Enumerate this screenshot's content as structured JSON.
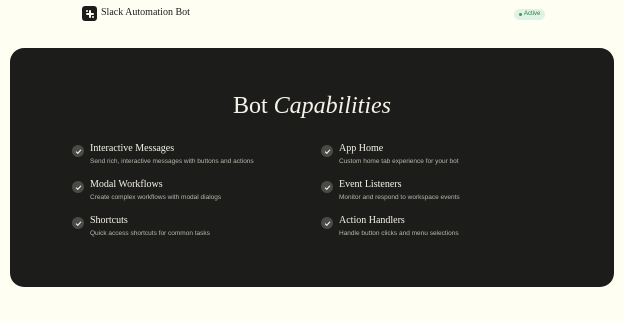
{
  "header": {
    "brand": "Slack Automation Bot",
    "status": "Active",
    "logo_icon": "slack-logo-icon"
  },
  "section": {
    "title_plain": "Bot",
    "title_italic": "Capabilities"
  },
  "features": [
    {
      "name": "Interactive Messages",
      "description": "Send rich, interactive messages with buttons and actions"
    },
    {
      "name": "App Home",
      "description": "Custom home tab experience for your bot"
    },
    {
      "name": "Modal Workflows",
      "description": "Create complex workflows with modal dialogs"
    },
    {
      "name": "Event Listeners",
      "description": "Monitor and respond to workspace events"
    },
    {
      "name": "Shortcuts",
      "description": "Quick access shortcuts for common tasks"
    },
    {
      "name": "Action Handlers",
      "description": "Handle button clicks and menu selections"
    }
  ],
  "colors": {
    "page_bg": "#fefef2",
    "panel_bg": "#1c1c1a",
    "status_bg": "#dff3e4",
    "status_text": "#2f7a46"
  }
}
